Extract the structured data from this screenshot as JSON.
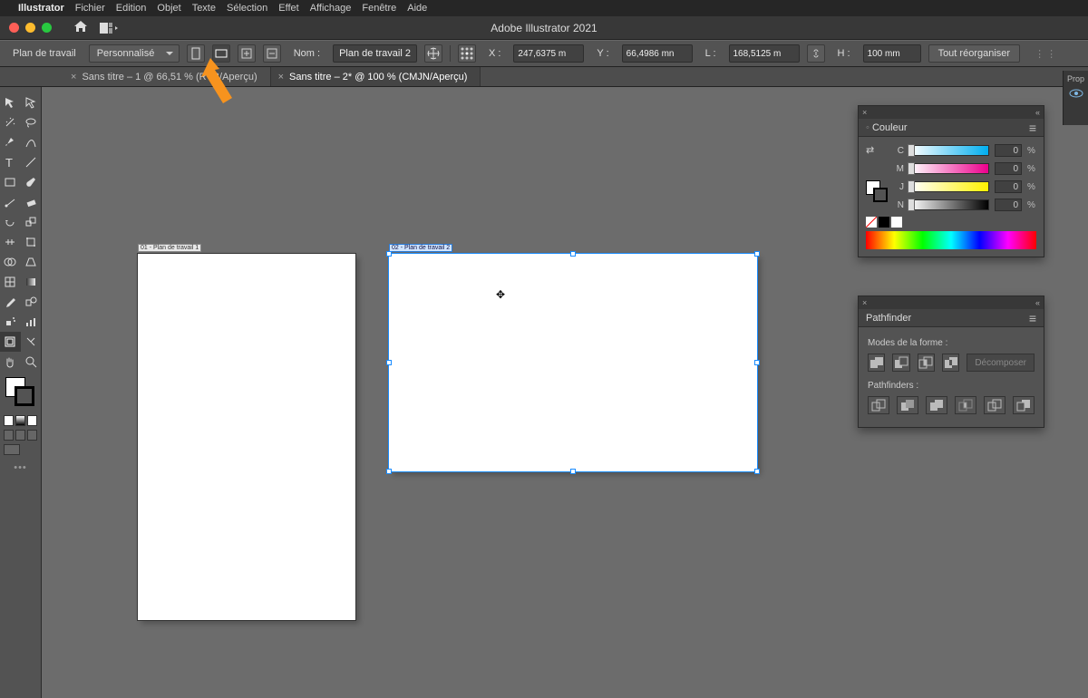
{
  "menubar": {
    "app": "Illustrator",
    "items": [
      "Fichier",
      "Edition",
      "Objet",
      "Texte",
      "Sélection",
      "Effet",
      "Affichage",
      "Fenêtre",
      "Aide"
    ]
  },
  "title": "Adobe Illustrator 2021",
  "control": {
    "context": "Plan de travail",
    "preset": "Personnalisé",
    "nom_label": "Nom :",
    "nom_value": "Plan de travail 2",
    "x_label": "X :",
    "x_value": "247,6375 m",
    "y_label": "Y :",
    "y_value": "66,4986 mn",
    "l_label": "L :",
    "l_value": "168,5125 m",
    "h_label": "H :",
    "h_value": "100 mm",
    "rearrange": "Tout  réorganiser"
  },
  "tabs": [
    {
      "label": "Sans titre – 1 @ 66,51 % (RVB/Aperçu)"
    },
    {
      "label": "Sans titre – 2* @ 100 % (CMJN/Aperçu)"
    }
  ],
  "artboards": {
    "ab1_label": "01 - Plan de travail 1",
    "ab2_label": "02 - Plan de travail 2"
  },
  "right": {
    "prop": "Prop"
  },
  "color_panel": {
    "title": "Couleur",
    "rows": [
      {
        "label": "C",
        "value": "0"
      },
      {
        "label": "M",
        "value": "0"
      },
      {
        "label": "J",
        "value": "0"
      },
      {
        "label": "N",
        "value": "0"
      }
    ],
    "pct": "%"
  },
  "pathfinder": {
    "title": "Pathfinder",
    "shape_modes": "Modes de la forme :",
    "decompose": "Décomposer",
    "pathfinders": "Pathfinders :"
  }
}
